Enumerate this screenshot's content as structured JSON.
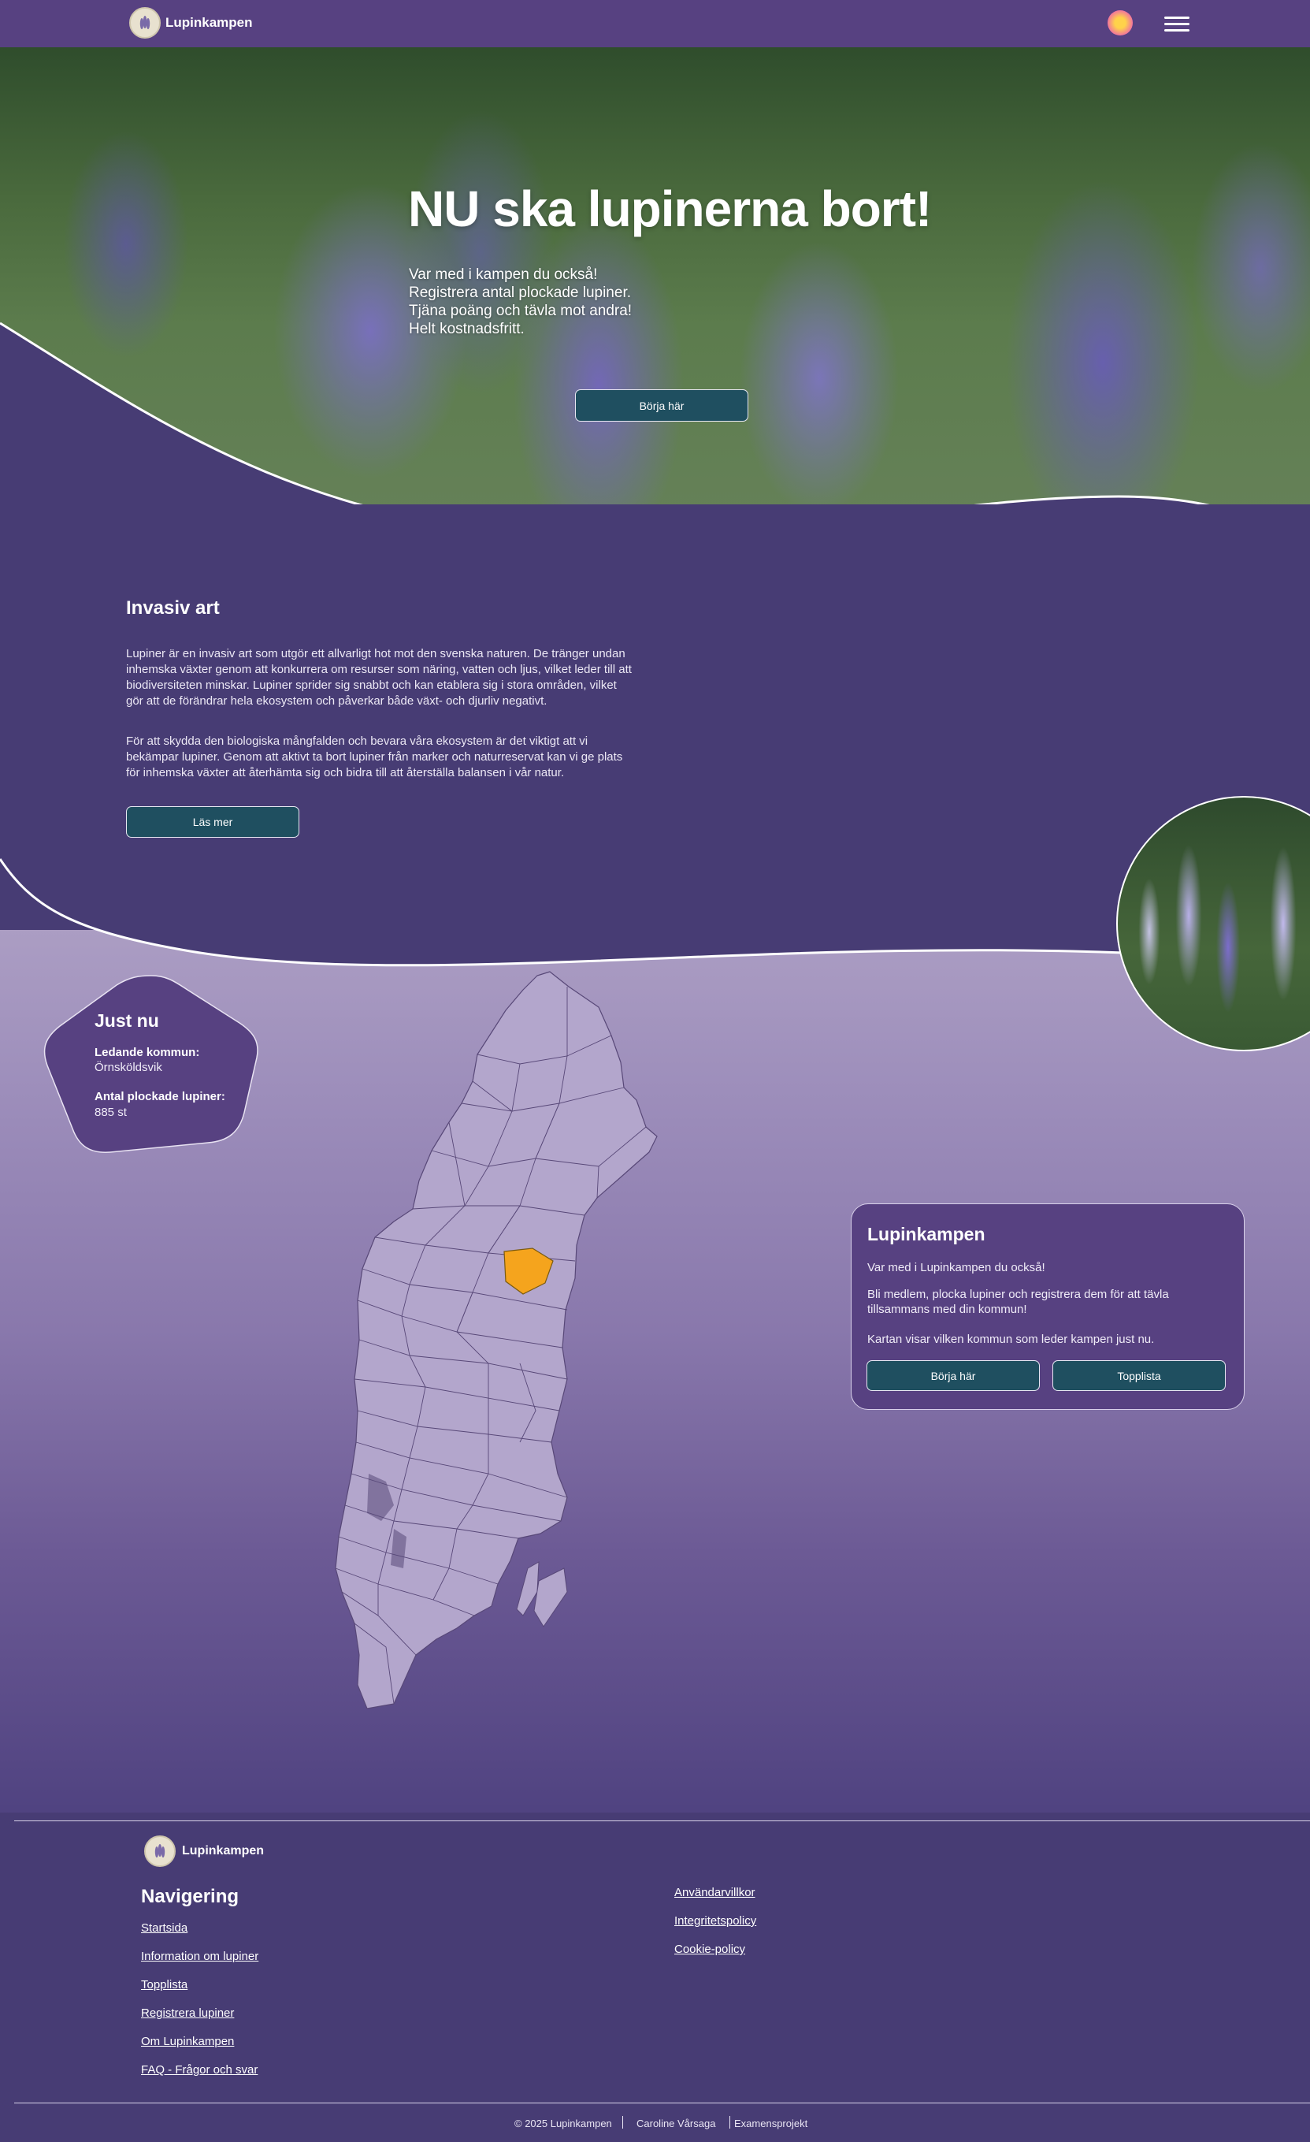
{
  "header": {
    "brand": "Lupinkampen",
    "theme_icon": "sun-icon",
    "menu_icon": "hamburger-icon"
  },
  "hero": {
    "title": "NU ska lupinerna bort!",
    "lines": [
      "Var med i kampen du också!",
      "Registrera antal plockade lupiner.",
      "Tjäna poäng och tävla mot andra!",
      "Helt kostnadsfritt."
    ],
    "cta": "Börja här"
  },
  "invasive": {
    "heading": "Invasiv art",
    "paragraph1_lines": [
      "Lupiner är en invasiv art som utgör ett allvarligt hot mot den svenska naturen. De tränger undan",
      "inhemska växter genom att konkurrera om resurser som näring, vatten och ljus, vilket leder till att",
      "biodiversiteten minskar. Lupiner sprider sig snabbt och kan etablera sig i stora områden, vilket",
      "gör att de förändrar hela ekosystem och påverkar både växt- och djurliv negativt."
    ],
    "paragraph2_lines": [
      "För att skydda den biologiska mångfalden och bevara våra ekosystem är det viktigt att vi",
      "bekämpar lupiner. Genom att aktivt ta bort lupiner från marker och naturreservat kan vi ge plats",
      "för inhemska växter att återhämta sig och bidra till att återställa balansen i vår natur."
    ],
    "read_more": "Läs mer"
  },
  "just_nu": {
    "title": "Just nu",
    "leading_label": "Ledande kommun:",
    "leading_value": "Örnsköldsvik",
    "count_label": "Antal plockade lupiner:",
    "count_value": "885 st"
  },
  "map": {
    "highlight_color": "#f5a41d",
    "base_color": "#b3a6cc"
  },
  "card": {
    "title": "Lupinkampen",
    "p1": "Var med i Lupinkampen du också!",
    "p2_lines": [
      "Bli medlem, plocka lupiner och registrera dem för att tävla",
      "tillsammans med din kommun!"
    ],
    "p3": "Kartan visar vilken kommun som leder kampen just nu.",
    "btn_start": "Börja här",
    "btn_top": "Topplista"
  },
  "footer": {
    "brand": "Lupinkampen",
    "nav_heading": "Navigering",
    "nav": [
      "Startsida",
      "Information om lupiner",
      "Topplista",
      "Registrera lupiner",
      "Om Lupinkampen",
      "FAQ - Frågor och svar"
    ],
    "legal": [
      "Användarvillkor",
      "Integritetspolicy",
      "Cookie-policy"
    ],
    "bottom": [
      "© 2025 Lupinkampen",
      "Caroline Vårsaga",
      "Examensprojekt"
    ]
  },
  "colors": {
    "header": "#574181",
    "button": "#1f4f60",
    "section_dark": "#473c74"
  }
}
